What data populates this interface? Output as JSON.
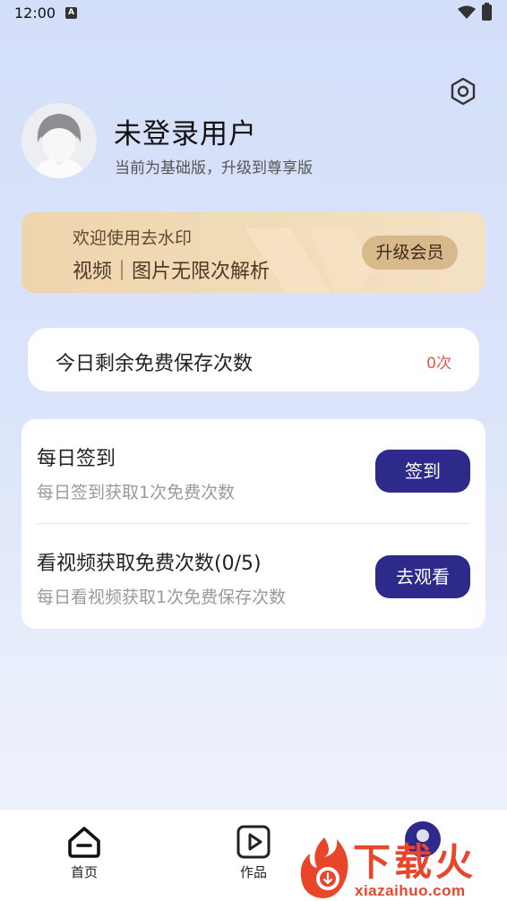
{
  "status_bar": {
    "time": "12:00",
    "notification": "A"
  },
  "profile": {
    "username": "未登录用户",
    "subtitle": "当前为基础版，升级到尊享版"
  },
  "vip_banner": {
    "line1": "欢迎使用去水印",
    "line2": "视频｜图片无限次解析",
    "button": "升级会员",
    "colors": {
      "background": "#efd5ad",
      "button": "#d7b98c"
    }
  },
  "free_quota": {
    "label": "今日剩余免费保存次数",
    "count": "0次",
    "count_color": "#e0594b"
  },
  "tasks": [
    {
      "title": "每日签到",
      "description": "每日签到获取1次免费次数",
      "button": "签到"
    },
    {
      "title": "看视频获取免费次数(0/5)",
      "description": "每日看视频获取1次免费保存次数",
      "button": "去观看"
    }
  ],
  "tab_bar": {
    "tabs": [
      {
        "label": "首页",
        "icon": "home-icon"
      },
      {
        "label": "作品",
        "icon": "video-play-icon"
      },
      {
        "label": "",
        "icon": "mine-icon"
      }
    ]
  },
  "watermark": {
    "text": "下载火",
    "url": "xiazaihuo.com"
  },
  "colors": {
    "accent": "#2d2a8c",
    "background": "#d3def9"
  }
}
